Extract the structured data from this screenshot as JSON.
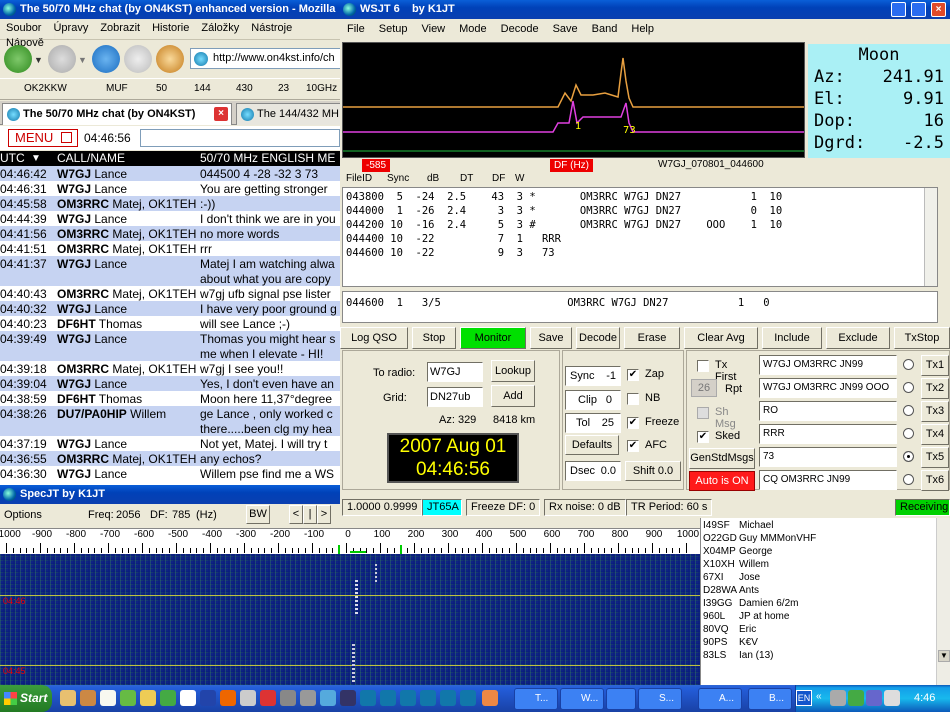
{
  "firefox": {
    "title": "The 50/70 MHz chat (by ON4KST) enhanced version - Mozilla",
    "menu": [
      "Soubor",
      "Úpravy",
      "Zobrazit",
      "Historie",
      "Záložky",
      "Nástroje",
      "Nápově"
    ],
    "url": "http://www.on4kst.info/ch",
    "bookmarks": [
      "OK2KKW",
      "MUF",
      "50",
      "144",
      "430",
      "23",
      "10GHz"
    ],
    "tabs": [
      "The 50/70 MHz chat (by ON4KST)",
      "The 144/432 MH"
    ],
    "menu_button": "MENU",
    "clock": "04:46:56",
    "columns": {
      "utc": "UTC",
      "call": "CALL/NAME",
      "band": "50/70 MHz ENGLISH ME"
    },
    "chat": [
      {
        "t": "04:46:42",
        "c": "W7GJ",
        "n": "Lance",
        "m": "044500 4 -28 -32 3 73",
        "bg": "#c6d3f2",
        "h": 15
      },
      {
        "t": "04:46:31",
        "c": "W7GJ",
        "n": "Lance",
        "m": "You are getting stronger",
        "bg": "#fff",
        "h": 15
      },
      {
        "t": "04:45:58",
        "c": "OM3RRC",
        "n": "Matej, OK1TEH",
        "m": ":-))",
        "bg": "#c6d3f2",
        "h": 15
      },
      {
        "t": "04:44:39",
        "c": "W7GJ",
        "n": "Lance",
        "m": "I don't think we are in you",
        "bg": "#fff",
        "h": 15
      },
      {
        "t": "04:41:56",
        "c": "OM3RRC",
        "n": "Matej, OK1TEH",
        "m": "no more words",
        "bg": "#c6d3f2",
        "h": 15
      },
      {
        "t": "04:41:51",
        "c": "OM3RRC",
        "n": "Matej, OK1TEH",
        "m": "rrr",
        "bg": "#fff",
        "h": 15
      },
      {
        "t": "04:41:37",
        "c": "W7GJ",
        "n": "Lance",
        "m": "Matej I am watching alwa",
        "m2": "about what you are copy",
        "bg": "#c6d3f2",
        "h": 30
      },
      {
        "t": "04:40:43",
        "c": "OM3RRC",
        "n": "Matej, OK1TEH",
        "m": "w7gj ufb signal pse lister",
        "bg": "#fff",
        "h": 15
      },
      {
        "t": "04:40:32",
        "c": "W7GJ",
        "n": "Lance",
        "m": "I have very poor ground g",
        "bg": "#c6d3f2",
        "h": 15
      },
      {
        "t": "04:40:23",
        "c": "DF6HT",
        "n": "Thomas",
        "m": "will see Lance ;-)",
        "bg": "#fff",
        "h": 15
      },
      {
        "t": "04:39:49",
        "c": "W7GJ",
        "n": "Lance",
        "m": "Thomas you might hear s",
        "m2": "me when I elevate - HI!",
        "bg": "#c6d3f2",
        "h": 30
      },
      {
        "t": "04:39:18",
        "c": "OM3RRC",
        "n": "Matej, OK1TEH",
        "m": "w7gj I see you!!",
        "bg": "#fff",
        "h": 15
      },
      {
        "t": "04:39:04",
        "c": "W7GJ",
        "n": "Lance",
        "m": "Yes, I don't even have an",
        "bg": "#c6d3f2",
        "h": 15
      },
      {
        "t": "04:38:59",
        "c": "DF6HT",
        "n": "Thomas",
        "m": "Moon here 11,37°degree",
        "bg": "#fff",
        "h": 15
      },
      {
        "t": "04:38:26",
        "c": "DU7/PA0HIP",
        "n": "Willem",
        "m": "ge Lance , only worked c",
        "m2": "there.....been clg my hea",
        "bg": "#c6d3f2",
        "h": 30
      },
      {
        "t": "04:37:19",
        "c": "W7GJ",
        "n": "Lance",
        "m": "Not yet, Matej. I will try t",
        "bg": "#fff",
        "h": 15
      },
      {
        "t": "04:36:55",
        "c": "OM3RRC",
        "n": "Matej, OK1TEH",
        "m": "any echos?",
        "bg": "#c6d3f2",
        "h": 15
      },
      {
        "t": "04:36:30",
        "c": "W7GJ",
        "n": "Lance",
        "m": "Willem pse find me a WS",
        "bg": "#fff",
        "h": 15
      }
    ]
  },
  "specjt": {
    "title": "SpecJT by K1JT",
    "options": "Options",
    "freq_label": "Freq:",
    "freq": "2056",
    "df_label": "DF:",
    "df": "785",
    "df_unit": "(Hz)",
    "bw": "BW",
    "nav": [
      "<",
      "|",
      ">"
    ],
    "scale": [
      "-1000",
      "-900",
      "-800",
      "-700",
      "-600",
      "-500",
      "-400",
      "-300",
      "-200",
      "-100",
      "0",
      "100",
      "200",
      "300",
      "400",
      "500",
      "600",
      "700",
      "800",
      "900",
      "1000"
    ],
    "wf_times": [
      "04:46",
      "04:45"
    ]
  },
  "wsjt": {
    "title": "WSJT 6    by K1JT",
    "menu": [
      "File",
      "Setup",
      "View",
      "Mode",
      "Decode",
      "Save",
      "Band",
      "Help"
    ],
    "moon": {
      "title": "Moon",
      "az_label": "Az:",
      "az": "241.91",
      "el_label": "El:",
      "el": "9.91",
      "dop_label": "Dop:",
      "dop": "16",
      "dgrd_label": "Dgrd:",
      "dgrd": "-2.5"
    },
    "spec_labels": [
      "1",
      "73"
    ],
    "df_left": "-585",
    "df_mid": "DF (Hz)",
    "file": "W7GJ_070801_044600",
    "dec_cols": [
      "FileID",
      "Sync",
      "dB",
      "DT",
      "DF",
      "W"
    ],
    "decodes": [
      "043800  5  -24  2.5    43  3 *       OM3RRC W7GJ DN27           1  10",
      "044000  1  -26  2.4     3  3 *       OM3RRC W7GJ DN27           0  10",
      "044200 10  -16  2.4     5  3 #       OM3RRC W7GJ DN27    OOO    1  10",
      "044400 10  -22          7  1   RRR",
      "044600 10  -22          9  3   73"
    ],
    "avg": "044600  1   3/5                    OM3RRC W7GJ DN27           1   0",
    "buttons": [
      "Log QSO",
      "Stop",
      "Monitor",
      "Save",
      "Decode",
      "Erase",
      "Clear Avg",
      "Include",
      "Exclude",
      "TxStop"
    ],
    "to_radio_label": "To radio:",
    "to_radio": "W7GJ",
    "grid_label": "Grid:",
    "grid": "DN27ub",
    "lookup": "Lookup",
    "add": "Add",
    "az_label": "Az: 329",
    "dist": "8418 km",
    "date": "2007 Aug 01",
    "time": "04:46:56",
    "sync_label": "Sync",
    "sync": "-1",
    "clip_label": "Clip",
    "clip": "0",
    "tol_label": "Tol",
    "tol": "25",
    "defaults": "Defaults",
    "dsec_label": "Dsec",
    "dsec": "0.0",
    "shift": "Shift 0.0",
    "checks": [
      "Zap",
      "NB",
      "Freeze",
      "AFC"
    ],
    "tx_first": "Tx First",
    "rpt_val": "26",
    "rpt": "Rpt",
    "shmsg": "Sh Msg",
    "sked": "Sked",
    "genstd": "GenStdMsgs",
    "auto": "Auto is ON",
    "msgs": [
      "W7GJ OM3RRC JN99",
      "W7GJ OM3RRC JN99 OOO",
      "RO",
      "RRR",
      "73",
      "CQ OM3RRC JN99"
    ],
    "tx": [
      "Tx1",
      "Tx2",
      "Tx3",
      "Tx4",
      "Tx5",
      "Tx6"
    ],
    "status": [
      "1.0000  0.9999",
      "JT65A",
      "Freeze DF:  0",
      "Rx noise:  0 dB",
      "TR Period: 60 s",
      "Receiving"
    ]
  },
  "callsigns": [
    {
      "c": "I49SF",
      "n": "Michael"
    },
    {
      "c": "O22GD",
      "n": "Guy MMMonVHF"
    },
    {
      "c": "X04MP",
      "n": "George"
    },
    {
      "c": "X10XH",
      "n": "Willem"
    },
    {
      "c": "67XI",
      "n": "Jose"
    },
    {
      "c": "D28WA",
      "n": "Ants"
    },
    {
      "c": "I39GG",
      "n": "Damien 6/2m"
    },
    {
      "c": "960L",
      "n": "JP at home"
    },
    {
      "c": "80VQ",
      "n": "Eric"
    },
    {
      "c": "90PS",
      "n": "K€V"
    },
    {
      "c": "83LS",
      "n": "Ian (13)"
    }
  ],
  "taskbar": {
    "start": "Start",
    "tasks": [
      "T...",
      "W...",
      "",
      "S...",
      "A...",
      "B..."
    ],
    "lang": "EN",
    "clock": "4:46"
  },
  "colors": {
    "xp_blue": "#0a3fb0",
    "chat_alt": "#c6d3f2",
    "monitor": "#00e000",
    "receiving": "#00d000",
    "auto_on": "#ff1a1a",
    "mode": "#00ffff",
    "clock_bg": "#000000",
    "clock_fg": "#ffff00"
  }
}
